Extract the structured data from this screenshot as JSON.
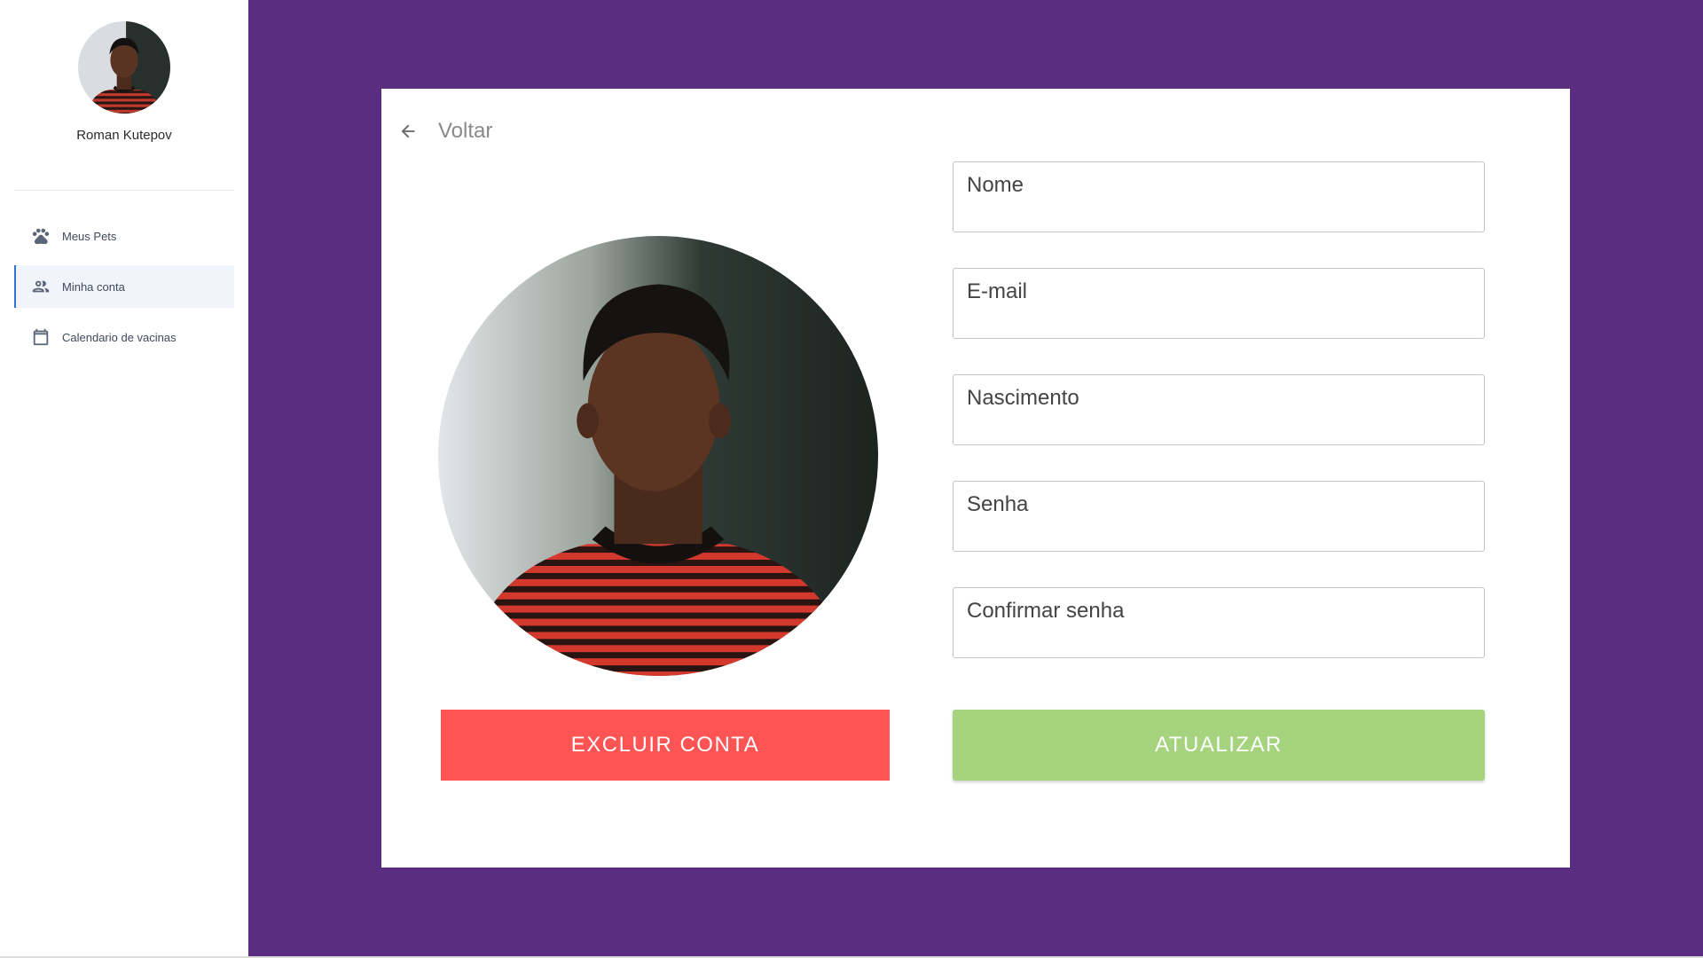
{
  "sidebar": {
    "user_name": "Roman Kutepov",
    "items": [
      {
        "label": "Meus Pets",
        "icon": "paw-icon",
        "active": false
      },
      {
        "label": "Minha conta",
        "icon": "people-icon",
        "active": true
      },
      {
        "label": "Calendario de vacinas",
        "icon": "calendar-icon",
        "active": false
      }
    ]
  },
  "main": {
    "back_label": "Voltar",
    "fields": {
      "name": {
        "label": "Nome",
        "value": ""
      },
      "email": {
        "label": "E-mail",
        "value": ""
      },
      "birth": {
        "label": "Nascimento",
        "value": ""
      },
      "password": {
        "label": "Senha",
        "value": ""
      },
      "confirm": {
        "label": "Confirmar senha",
        "value": ""
      }
    },
    "delete_button": "EXCLUIR CONTA",
    "update_button": "ATUALIZAR"
  },
  "colors": {
    "background": "#5b2d81",
    "danger": "#ff5454",
    "success": "#a6d37d",
    "active_accent": "#2f73d8"
  }
}
